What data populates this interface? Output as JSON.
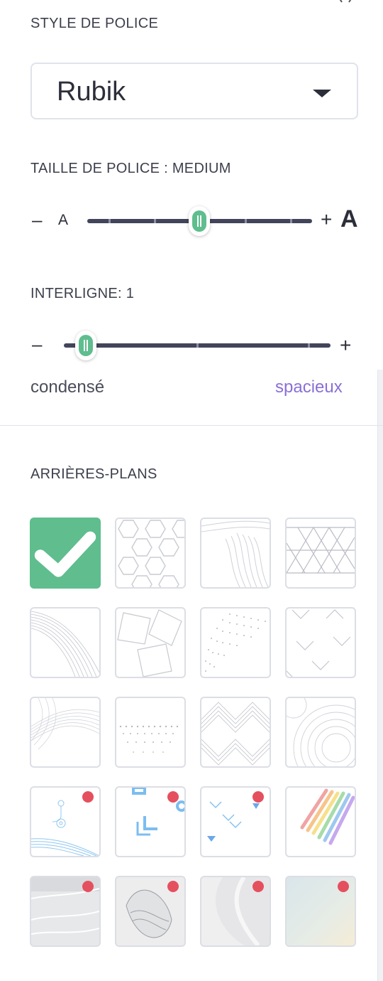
{
  "font_style": {
    "label": "STYLE DE POLICE",
    "selected": "Rubik"
  },
  "font_size": {
    "label": "TAILLE DE POLICE : MEDIUM",
    "decrease_label": "A",
    "increase_label": "A",
    "steps": 6,
    "value_index": 3
  },
  "line_height": {
    "label": "INTERLIGNE: 1",
    "steps": 3,
    "value_index": 0,
    "min_label": "condensé",
    "max_label": "spacieux"
  },
  "backgrounds": {
    "label": "ARRIÈRES-PLANS",
    "selected_index": 0,
    "tiles": [
      {
        "name": "plain",
        "premium": false
      },
      {
        "name": "hexagons",
        "premium": false
      },
      {
        "name": "contour-lines",
        "premium": false
      },
      {
        "name": "triangle-grid",
        "premium": false
      },
      {
        "name": "curved-lines",
        "premium": false
      },
      {
        "name": "squares",
        "premium": false
      },
      {
        "name": "dot-wave",
        "premium": false
      },
      {
        "name": "chevrons",
        "premium": false
      },
      {
        "name": "line-tunnel",
        "premium": false
      },
      {
        "name": "dot-perspective",
        "premium": false
      },
      {
        "name": "zigzag",
        "premium": false
      },
      {
        "name": "circles",
        "premium": false
      },
      {
        "name": "blue-circuit",
        "premium": true
      },
      {
        "name": "blue-shapes",
        "premium": true
      },
      {
        "name": "blue-arrows",
        "premium": true
      },
      {
        "name": "rainbow-stripes",
        "premium": false
      },
      {
        "name": "grey-waves",
        "premium": true
      },
      {
        "name": "leaf",
        "premium": true
      },
      {
        "name": "soft-shape",
        "premium": true
      },
      {
        "name": "pastel-gradient",
        "premium": true
      }
    ]
  },
  "colors": {
    "accent": "#5fbd8e",
    "secondary_text": "#8a6fd6",
    "premium_dot": "#e5505e",
    "track": "#42455a"
  }
}
